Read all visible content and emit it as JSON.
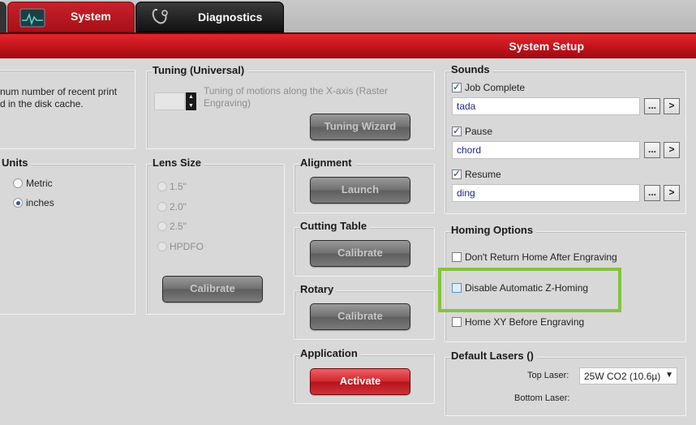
{
  "tabs": [
    {
      "label": "System",
      "icon": "pulse-monitor-icon",
      "active": true
    },
    {
      "label": "Diagnostics",
      "icon": "stethoscope-icon",
      "active": false
    }
  ],
  "header": {
    "title": "System Setup"
  },
  "cache_group": {
    "text_line1": "num number of recent print",
    "text_line2": "d in the disk cache."
  },
  "tuning": {
    "title": "Tuning (Universal)",
    "description_line1": "Tuning of motions along the X-axis (Raster",
    "description_line2": "Engraving)",
    "wizard_label": "Tuning Wizard"
  },
  "units": {
    "title": "Units",
    "options": [
      "Metric",
      "inches"
    ],
    "selected": "inches"
  },
  "lens": {
    "title": "Lens Size",
    "options": [
      "1.5\"",
      "2.0\"",
      "2.5\"",
      "HPDFO"
    ],
    "calibrate_label": "Calibrate"
  },
  "alignment": {
    "title": "Alignment",
    "button_label": "Launch"
  },
  "cutting_table": {
    "title": "Cutting Table",
    "button_label": "Calibrate"
  },
  "rotary": {
    "title": "Rotary",
    "button_label": "Calibrate"
  },
  "application": {
    "title": "Application",
    "button_label": "Activate"
  },
  "sounds": {
    "title": "Sounds",
    "items": [
      {
        "label": "Job Complete",
        "checked": true,
        "value": "tada"
      },
      {
        "label": "Pause",
        "checked": true,
        "value": "chord"
      },
      {
        "label": "Resume",
        "checked": true,
        "value": "ding"
      }
    ],
    "browse_label": "...",
    "play_label": ">"
  },
  "homing": {
    "title": "Homing Options",
    "options": [
      {
        "label": "Don't Return Home After Engraving",
        "checked": false
      },
      {
        "label": "Disable Automatic Z-Homing",
        "checked": false
      },
      {
        "label": "Home XY Before Engraving",
        "checked": false
      }
    ],
    "highlight_color": "#84c43c"
  },
  "default_lasers": {
    "title": "Default Lasers ()",
    "top_label": "Top Laser:",
    "top_value": "25W CO2 (10.6µ)",
    "bottom_label": "Bottom Laser:"
  },
  "colors": {
    "accent": "#c3121a",
    "background": "#d8d8d8"
  }
}
